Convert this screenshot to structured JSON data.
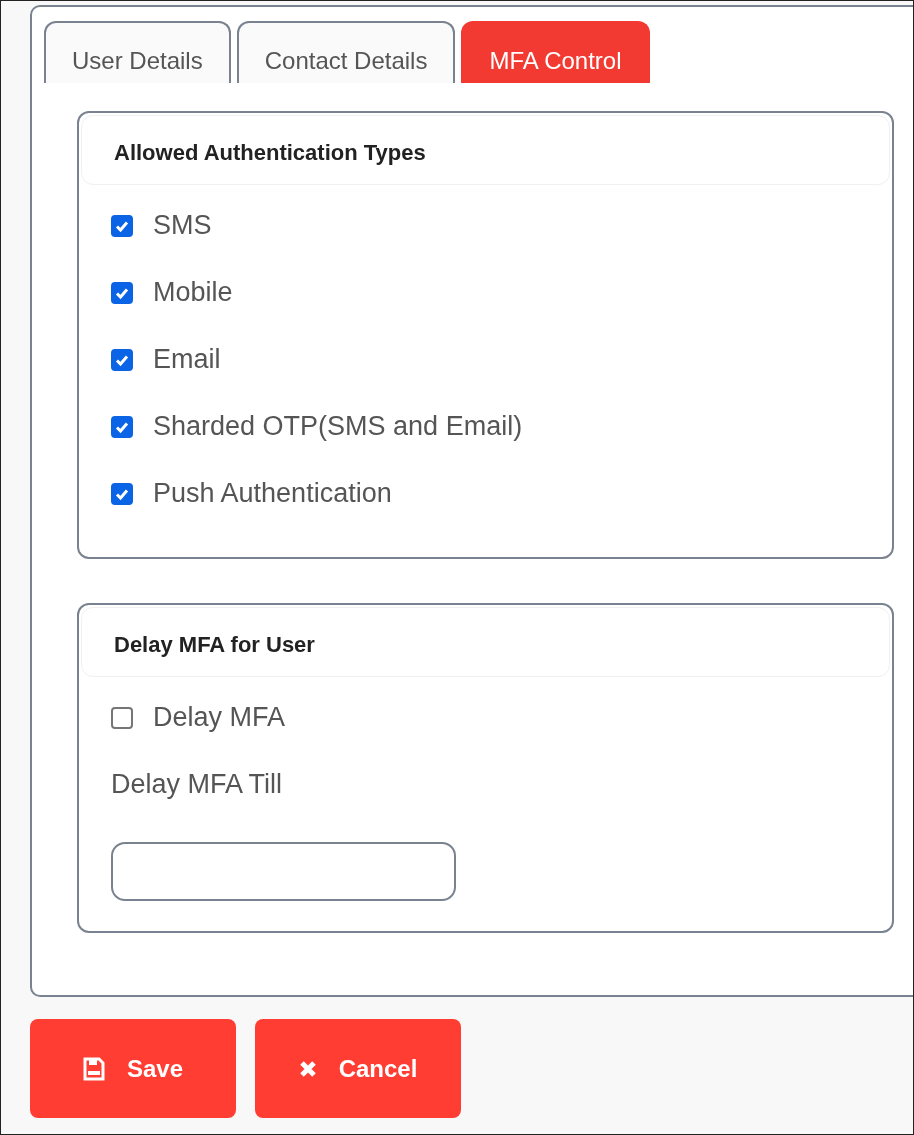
{
  "tabs": [
    {
      "label": "User Details",
      "selected": false
    },
    {
      "label": "Contact Details",
      "selected": false
    },
    {
      "label": "MFA Control",
      "selected": true
    }
  ],
  "sections": [
    {
      "title": "Allowed Authentication Types",
      "items": [
        {
          "kind": "checkbox",
          "label": "SMS",
          "checked": true
        },
        {
          "kind": "checkbox",
          "label": "Mobile",
          "checked": true
        },
        {
          "kind": "checkbox",
          "label": "Email",
          "checked": true
        },
        {
          "kind": "checkbox",
          "label": "Sharded OTP(SMS and Email)",
          "checked": true
        },
        {
          "kind": "checkbox",
          "label": "Push Authentication",
          "checked": true
        }
      ]
    },
    {
      "title": "Delay MFA for User",
      "items": [
        {
          "kind": "checkbox",
          "label": "Delay MFA",
          "checked": false
        },
        {
          "kind": "date",
          "label": "Delay MFA Till"
        }
      ]
    }
  ],
  "buttons": [
    {
      "kind": "save",
      "label": "Save"
    },
    {
      "kind": "cancel",
      "label": "Cancel"
    }
  ]
}
